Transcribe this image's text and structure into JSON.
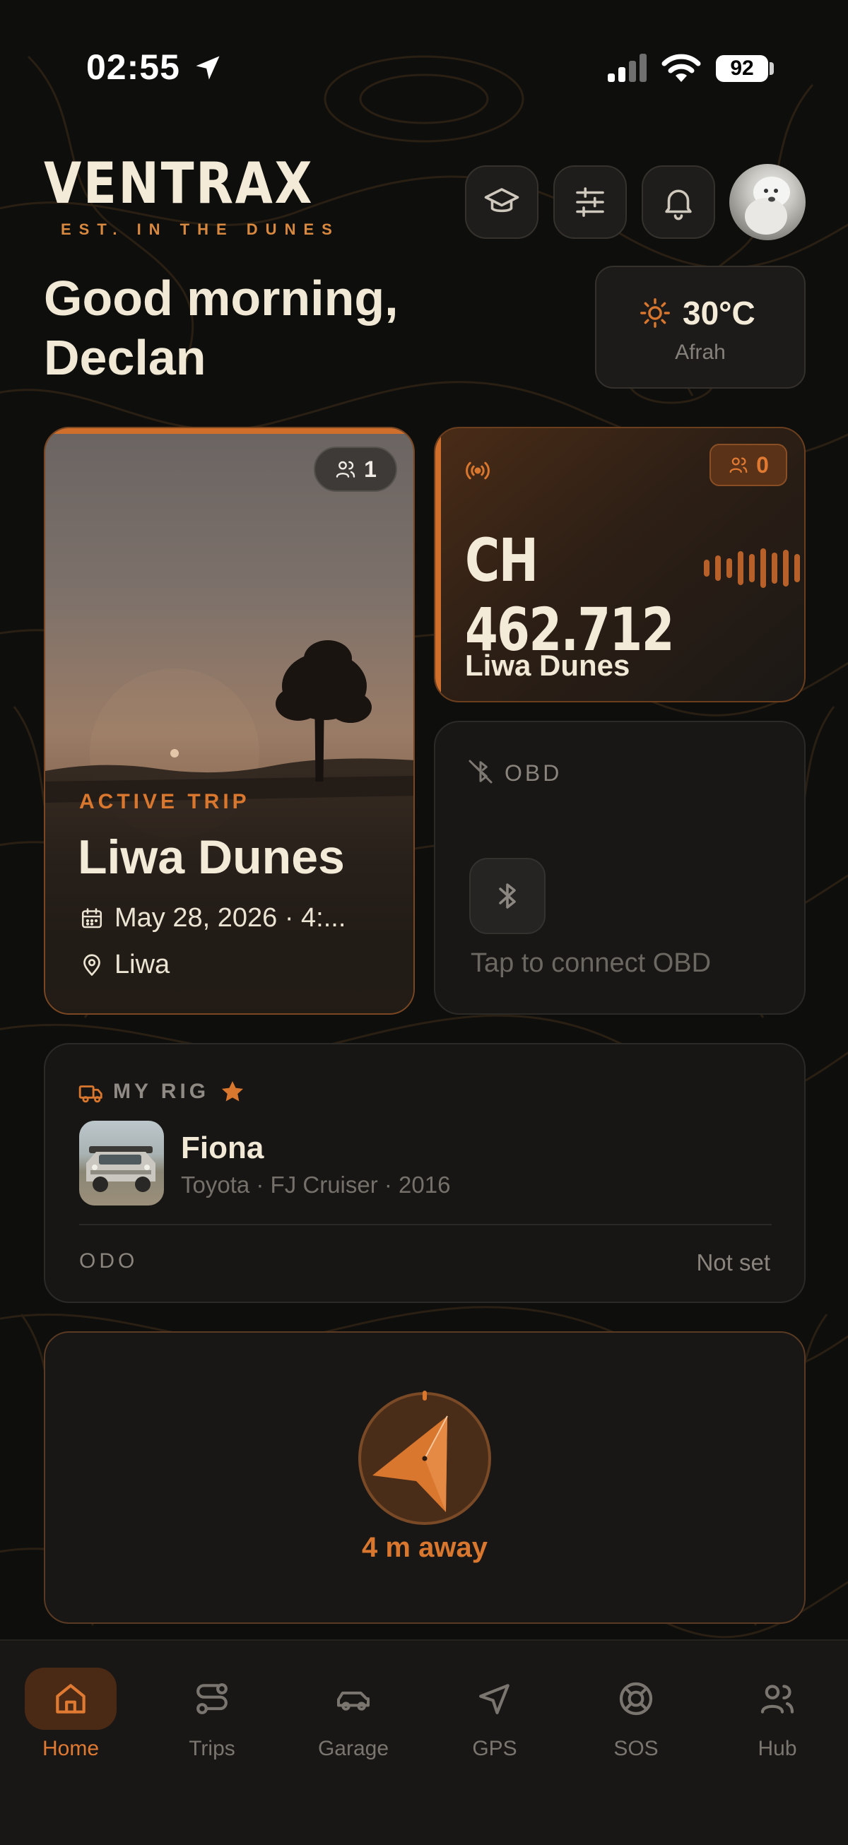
{
  "status_bar": {
    "time": "02:55",
    "battery": "92"
  },
  "header": {
    "logo": "VENTRAX",
    "logo_tagline": "EST. IN THE DUNES"
  },
  "greeting": {
    "line1": "Good morning,",
    "line2": "Declan"
  },
  "weather": {
    "temp": "30°C",
    "location": "Afrah",
    "icon": "sun-icon"
  },
  "trip_card": {
    "participants": "1",
    "label": "ACTIVE TRIP",
    "title": "Liwa Dunes",
    "date": "May 28, 2026 · 4:...",
    "place": "Liwa"
  },
  "radio_card": {
    "participants": "0",
    "channel": "CH 462.712",
    "name": "Liwa Dunes"
  },
  "obd_card": {
    "label": "OBD",
    "prompt": "Tap to connect OBD"
  },
  "rig_card": {
    "label": "MY RIG",
    "name": "Fiona",
    "details": "Toyota · FJ Cruiser · 2016",
    "odo_label": "ODO",
    "odo_value": "Not set"
  },
  "compass_card": {
    "distance": "4 m away"
  },
  "nav": {
    "items": [
      {
        "label": "Home",
        "icon": "home-icon",
        "active": true
      },
      {
        "label": "Trips",
        "icon": "route-icon",
        "active": false
      },
      {
        "label": "Garage",
        "icon": "car-icon",
        "active": false
      },
      {
        "label": "GPS",
        "icon": "navigation-icon",
        "active": false
      },
      {
        "label": "SOS",
        "icon": "lifebuoy-icon",
        "active": false
      },
      {
        "label": "Hub",
        "icon": "users-icon",
        "active": false
      }
    ]
  },
  "colors": {
    "accent": "#d9772f",
    "background": "#0e0e0d",
    "card": "#181716",
    "text": "#efe6d6"
  }
}
